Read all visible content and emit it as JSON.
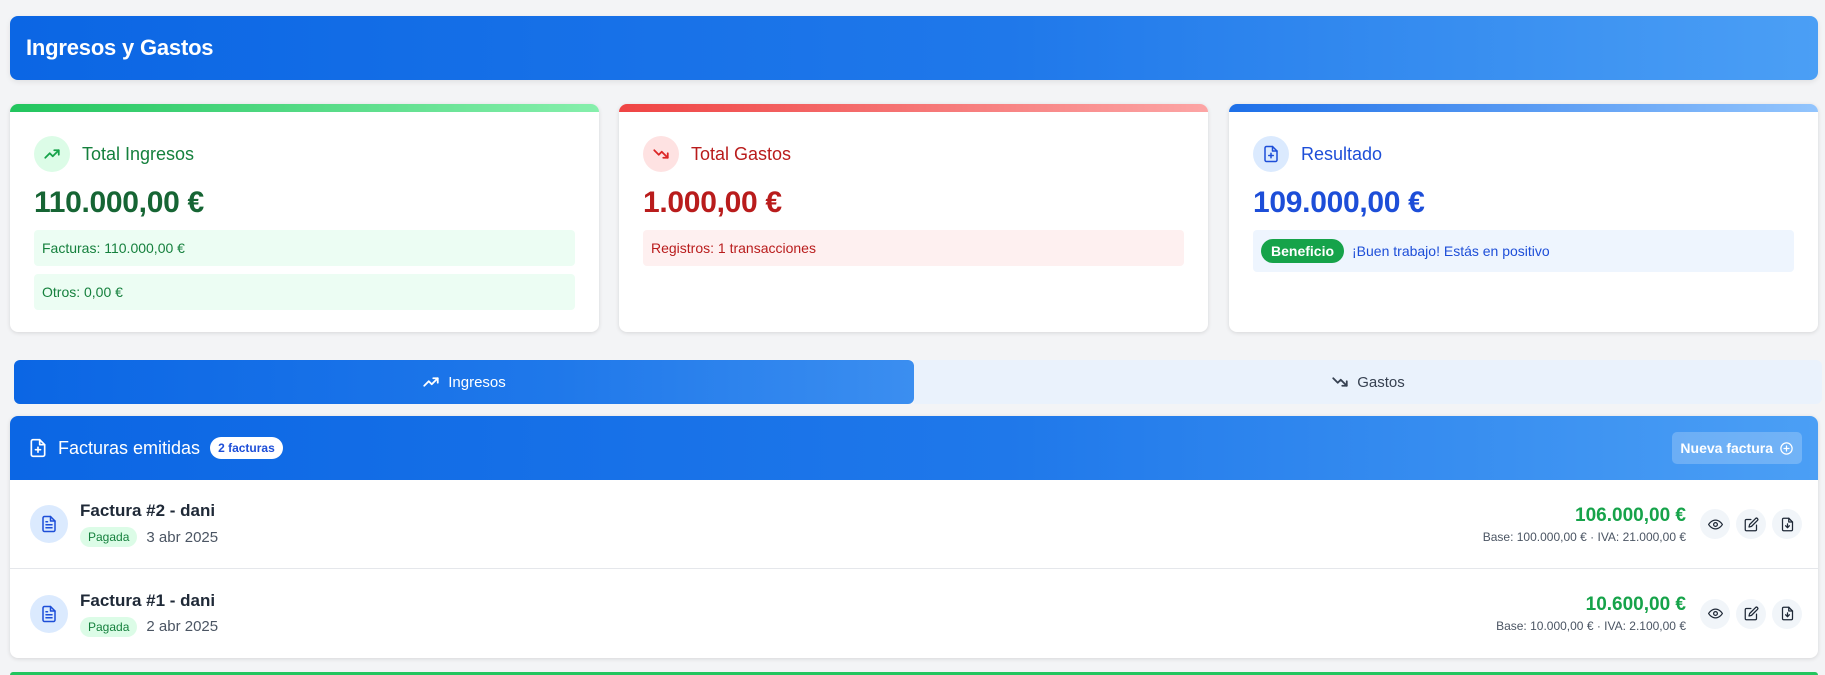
{
  "header": {
    "title": "Ingresos y Gastos"
  },
  "cards": {
    "ingresos": {
      "title": "Total Ingresos",
      "amount": "110.000,00 €",
      "info1": "Facturas: 110.000,00 €",
      "info2": "Otros: 0,00 €",
      "icon": "trending-up-icon"
    },
    "gastos": {
      "title": "Total Gastos",
      "amount": "1.000,00 €",
      "info1": "Registros: 1 transacciones",
      "icon": "trending-down-icon"
    },
    "resultado": {
      "title": "Resultado",
      "amount": "109.000,00 €",
      "badge": "Beneficio",
      "message": "¡Buen trabajo! Estás en positivo",
      "icon": "file-plus-icon"
    }
  },
  "tabs": [
    {
      "label": "Ingresos",
      "active": true
    },
    {
      "label": "Gastos",
      "active": false
    }
  ],
  "panel": {
    "title": "Facturas emitidas",
    "count": "2 facturas",
    "new_button": "Nueva factura"
  },
  "invoices": [
    {
      "name": "Factura #2 - dani",
      "status": "Pagada",
      "date": "3 abr 2025",
      "total": "106.000,00 €",
      "breakdown": "Base: 100.000,00 € · IVA: 21.000,00 €"
    },
    {
      "name": "Factura #1 - dani",
      "status": "Pagada",
      "date": "2 abr 2025",
      "total": "10.600,00 €",
      "breakdown": "Base: 10.000,00 € · IVA: 2.100,00 €"
    }
  ],
  "colors": {
    "primary": "#0b66e4",
    "income": "#16a34a",
    "expense": "#b91c1c"
  }
}
